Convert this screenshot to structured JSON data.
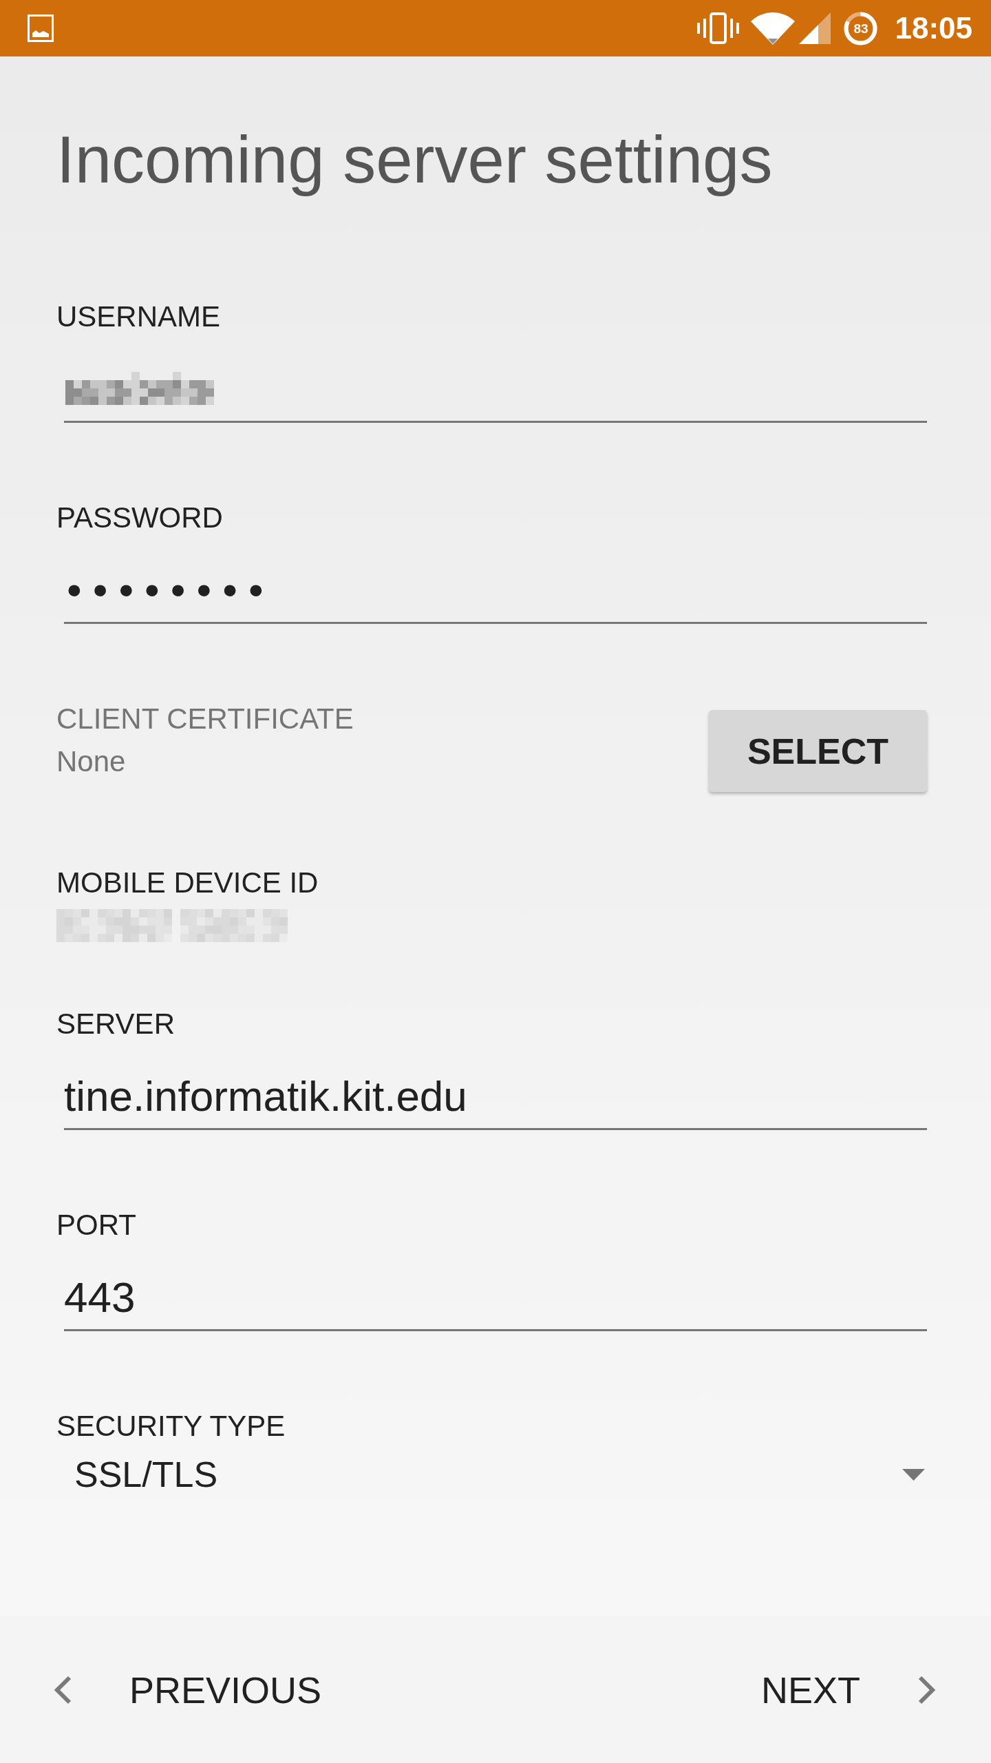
{
  "status_bar": {
    "battery": "83",
    "time": "18:05"
  },
  "title": "Incoming server settings",
  "fields": [
    {
      "kind": "text",
      "label": "USERNAME",
      "value_redacted": true
    },
    {
      "kind": "password",
      "label": "PASSWORD",
      "value": "••••••••"
    },
    {
      "kind": "certificate",
      "label": "CLIENT CERTIFICATE",
      "value": "None",
      "button": "SELECT"
    },
    {
      "kind": "readonly",
      "label": "MOBILE DEVICE ID",
      "value_redacted": true
    },
    {
      "kind": "text",
      "label": "SERVER",
      "value": "tine.informatik.kit.edu"
    },
    {
      "kind": "text",
      "label": "PORT",
      "value": "443"
    },
    {
      "kind": "dropdown",
      "label": "SECURITY TYPE",
      "value": "SSL/TLS"
    }
  ],
  "navigation": {
    "buttons": [
      {
        "kind": "previous",
        "label": "PREVIOUS"
      },
      {
        "kind": "next",
        "label": "NEXT"
      }
    ]
  }
}
